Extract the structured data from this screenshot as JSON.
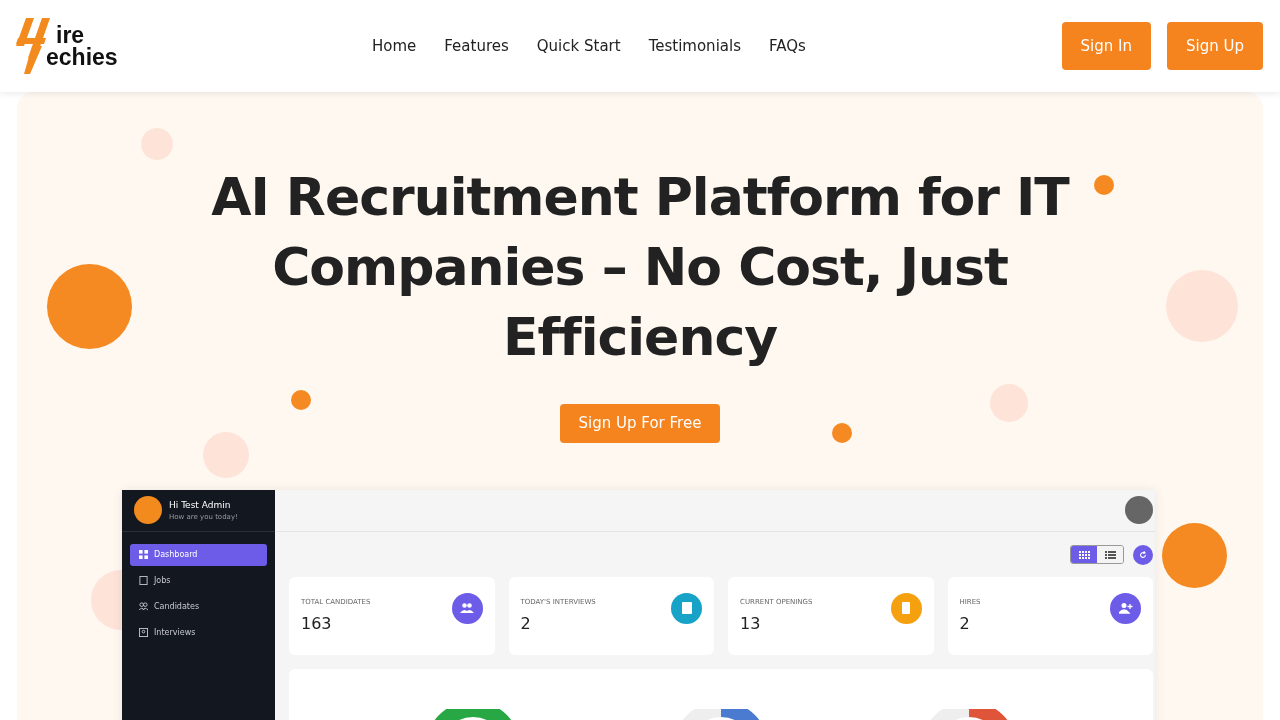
{
  "brand": {
    "line_1": "ire",
    "line_2": "echies"
  },
  "nav": [
    {
      "label": "Home"
    },
    {
      "label": "Features"
    },
    {
      "label": "Quick Start"
    },
    {
      "label": "Testimonials"
    },
    {
      "label": "FAQs"
    }
  ],
  "auth_buttons": [
    "Sign In",
    "Sign Up"
  ],
  "hero": {
    "title": "AI Recruitment Platform for IT Companies – No Cost, Just Efficiency",
    "cta": "Sign Up For Free"
  },
  "dashboard": {
    "greeting": "Hi Test Admin",
    "subtitle": "How are you today!",
    "menu": [
      {
        "label": "Dashboard",
        "kind": "grid",
        "selected": true
      },
      {
        "label": "Jobs",
        "kind": "clipboard",
        "selected": false
      },
      {
        "label": "Candidates",
        "kind": "people",
        "selected": false
      },
      {
        "label": "Interviews",
        "kind": "badge",
        "selected": false
      }
    ],
    "views": [
      {
        "kind": "grid",
        "selected": true
      },
      {
        "kind": "list",
        "selected": false
      }
    ],
    "stats": [
      {
        "label": "TOTAL CANDIDATES",
        "value": "163",
        "kind": "people",
        "color": "#6c5ce7"
      },
      {
        "label": "TODAY'S INTERVIEWS",
        "value": "2",
        "kind": "badge",
        "color": "#17a2c8"
      },
      {
        "label": "CURRENT OPENINGS",
        "value": "13",
        "kind": "clipboard",
        "color": "#f5a00f"
      },
      {
        "label": "HIRES",
        "value": "2",
        "kind": "add-user",
        "color": "#6c5ce7"
      }
    ]
  }
}
